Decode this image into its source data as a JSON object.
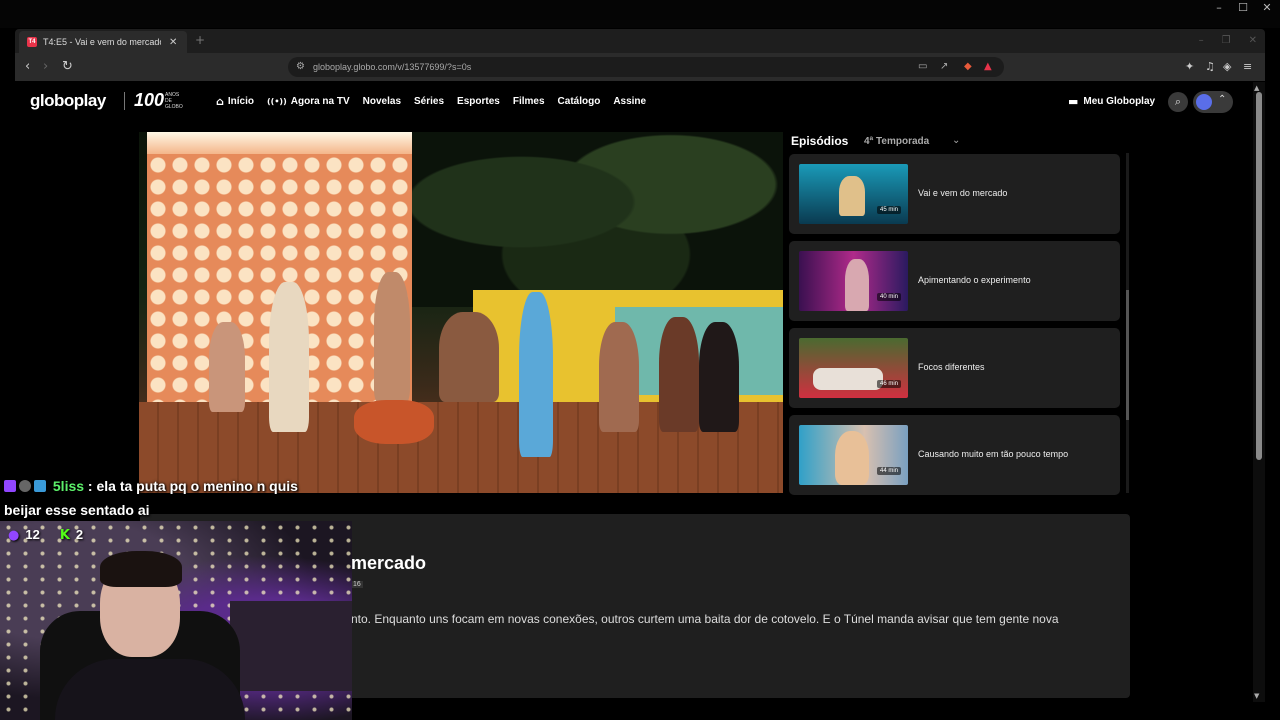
{
  "browser": {
    "window_controls": {
      "minimize": "–",
      "maximize": "☐",
      "close": "✕"
    },
    "tab": {
      "title": "T4:E5 - Vai e vem do mercado -",
      "favicon_text": "T4",
      "close_glyph": "✕"
    },
    "new_tab_glyph": "+",
    "strip_controls": {
      "minimize": "–",
      "restore": "❐",
      "close": "✕"
    },
    "nav": {
      "back": "‹",
      "forward": "›",
      "reload": "↻"
    },
    "url": "globoplay.globo.com/v/13577699/?s=0s"
  },
  "site": {
    "logo": "globoplay",
    "logo_100": "100",
    "logo_anos": "ANOS DE GLOBO",
    "nav": [
      {
        "label": "Início",
        "icon": "home-icon",
        "glyph": "⌂"
      },
      {
        "label": "Agora na TV",
        "icon": "broadcast-icon",
        "glyph": "((•))"
      },
      {
        "label": "Novelas"
      },
      {
        "label": "Séries"
      },
      {
        "label": "Esportes"
      },
      {
        "label": "Filmes"
      },
      {
        "label": "Catálogo"
      },
      {
        "label": "Assine"
      }
    ],
    "meu_globoplay": "Meu Globoplay",
    "accent": "#5a6ee8"
  },
  "episodes": {
    "title": "Episódios",
    "season": "4ª Temporada",
    "items": [
      {
        "title": "Vai e vem do mercado",
        "duration": "45 min"
      },
      {
        "title": "Apimentando o experimento",
        "duration": "40 min"
      },
      {
        "title": "Focos diferentes",
        "duration": "46 min"
      },
      {
        "title": "Causando muito em tão pouco tempo",
        "duration": "44 min"
      }
    ]
  },
  "details": {
    "title_fragment": "mercado",
    "badge": "16",
    "description_fragment": "nto. Enquanto uns focam em novas conexões, outros curtem uma baita dor de cotovelo. E o Túnel manda avisar que tem gente nova"
  },
  "chat": {
    "username": "5liss",
    "message_line1": ": ela ta puta pq o menino n quis",
    "message_line2": "beijar esse sentado ai"
  },
  "stream": {
    "viewers": "12",
    "kick_count": "2"
  }
}
